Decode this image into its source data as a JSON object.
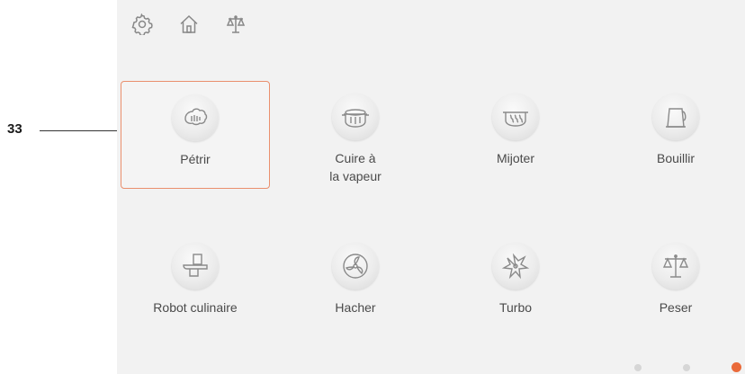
{
  "callout": {
    "number": "33"
  },
  "top_icons": [
    "settings-gear-icon",
    "home-icon",
    "scale-icon"
  ],
  "tiles_row1": [
    {
      "label": "Pétrir",
      "icon": "knead-icon",
      "selected": true
    },
    {
      "label": "Cuire à\nla vapeur",
      "icon": "steam-pot-icon",
      "selected": false
    },
    {
      "label": "Mijoter",
      "icon": "simmer-pot-icon",
      "selected": false
    },
    {
      "label": "Bouillir",
      "icon": "kettle-icon",
      "selected": false
    }
  ],
  "tiles_row2": [
    {
      "label": "Robot culinaire",
      "icon": "food-processor-icon",
      "selected": false
    },
    {
      "label": "Hacher",
      "icon": "chop-blade-icon",
      "selected": false
    },
    {
      "label": "Turbo",
      "icon": "turbo-icon",
      "selected": false
    },
    {
      "label": "Peser",
      "icon": "scale-icon",
      "selected": false
    }
  ],
  "pagination": {
    "pages": 3,
    "active_index": 2
  },
  "colors": {
    "accent": "#ea6a3a",
    "selected_border": "#ea8f6d",
    "background": "#f2f2f2"
  }
}
